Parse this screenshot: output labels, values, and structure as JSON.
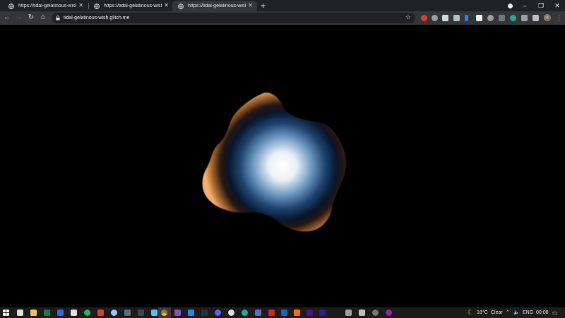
{
  "browser": {
    "tabs": [
      {
        "title": "https://tidal-gelatinous-wish.glitch.me/",
        "active": false
      },
      {
        "title": "https://tidal-gelatinous-wish.glitch.me/",
        "active": false
      },
      {
        "title": "https://tidal-gelatinous-wish.glitch.me/",
        "active": true
      }
    ],
    "new_tab_symbol": "+",
    "address": "tidal-gelatinous-wish.glitch.me",
    "window_controls": {
      "minimize": "–",
      "maximize": "❐",
      "close": "✕"
    }
  },
  "page": {
    "background": "#000000",
    "blob_colors": {
      "center": "#ffffff",
      "mid": "#4a7aa6",
      "dark": "#0a1a2e",
      "rim": "#e8a25c"
    }
  },
  "taskbar": {
    "weather_temp": "18°C",
    "weather_desc": "Clear",
    "language": "ENG",
    "time": "00:08",
    "pinned_icons": [
      "windows-start",
      "search",
      "task-view",
      "file-explorer",
      "excel",
      "mail",
      "spotify",
      "app-red",
      "browser-circle",
      "calendar",
      "steam",
      "chrome",
      "visual-studio",
      "vscode",
      "dark-app",
      "discord",
      "app-a",
      "app-b",
      "teams",
      "filezilla",
      "illustrator",
      "premiere",
      "after-effects",
      "app-c",
      "app-d",
      "obs",
      "app-e"
    ]
  }
}
